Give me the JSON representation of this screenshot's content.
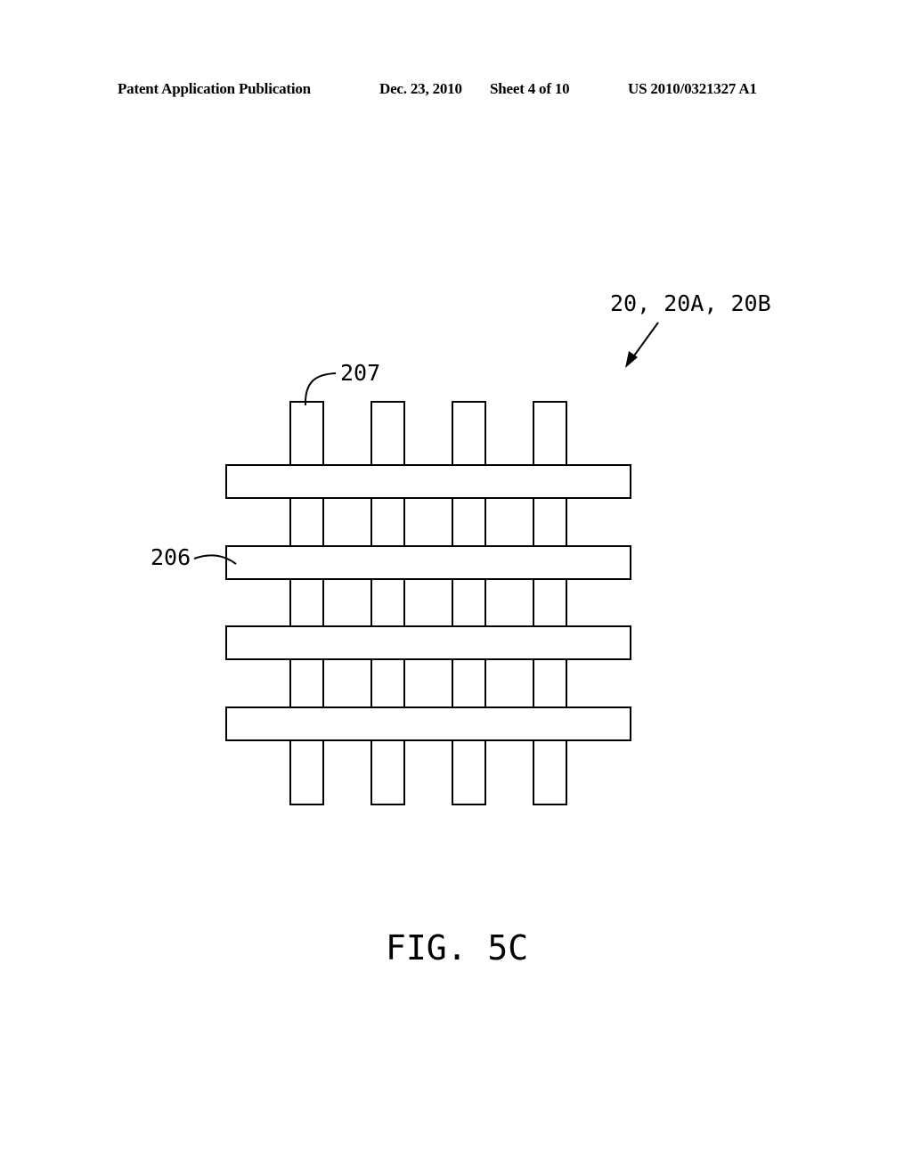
{
  "header": {
    "publication_type": "Patent Application Publication",
    "date": "Dec. 23, 2010",
    "sheet": "Sheet 4 of 10",
    "publication_number": "US 2010/0321327 A1"
  },
  "figure": {
    "caption": "FIG. 5C",
    "reference_labels": {
      "assembly": "20, 20A, 20B",
      "vertical_strip": "207",
      "horizontal_strip": "206"
    },
    "vertical_strip_count": 4,
    "horizontal_strip_count": 4
  }
}
